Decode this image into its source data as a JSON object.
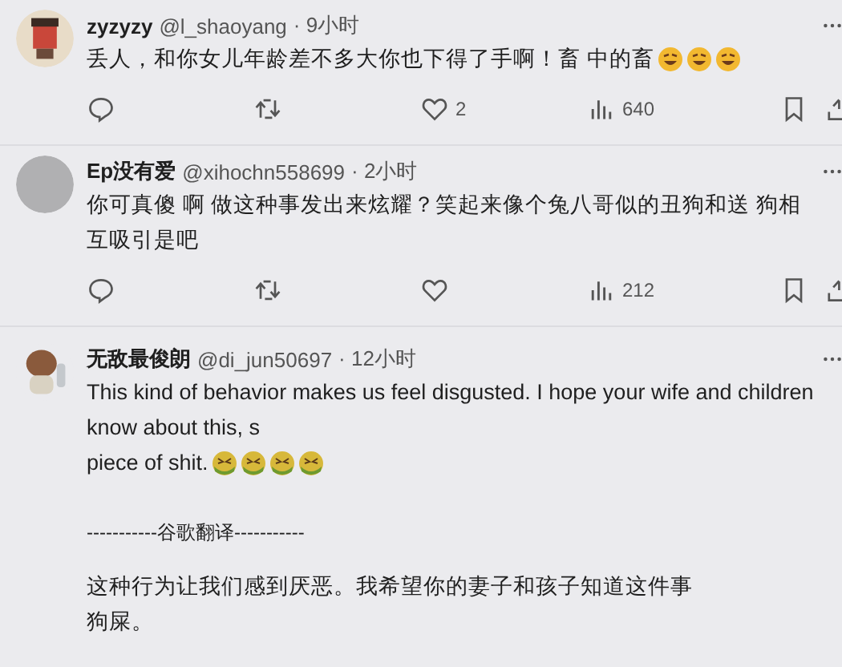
{
  "replies": [
    {
      "avatar": {
        "kind": "figure"
      },
      "display_name": "zyzyzy",
      "handle": "@l_shaoyang",
      "time": "· 9小时",
      "lines": [
        "丢人，和你女儿年龄差不多大你也下得了手啊！畜 中的畜"
      ],
      "emojis": [
        {
          "kind": "laughing"
        },
        {
          "kind": "laughing"
        },
        {
          "kind": "laughing"
        }
      ],
      "actions": {
        "likes": "2",
        "views": "640"
      }
    },
    {
      "avatar": {
        "kind": "plain"
      },
      "display_name": "Ep没有爱",
      "handle": "@xihochn558699",
      "time": "· 2小时",
      "lines": [
        "你可真傻 啊 做这种事发出来炫耀？笑起来像个兔八哥似的丑狗和送 狗相",
        "互吸引是吧"
      ],
      "actions": {
        "views": "212"
      }
    },
    {
      "avatar": {
        "kind": "potato"
      },
      "display_name": "无敌最俊朗",
      "handle": "@di_jun50697",
      "time": "· 12小时",
      "lines": [
        "This kind of behavior makes us feel disgusted. I hope your wife and children",
        "know about this, s",
        "piece of shit."
      ],
      "emojis": [
        {
          "kind": "nauseated"
        },
        {
          "kind": "nauseated"
        },
        {
          "kind": "nauseated"
        },
        {
          "kind": "nauseated"
        }
      ],
      "translation": {
        "header": "-----------谷歌翻译-----------",
        "lines": [
          "这种行为让我们感到厌恶。我希望你的妻子和孩子知道这件事",
          "狗屎。"
        ]
      }
    }
  ]
}
